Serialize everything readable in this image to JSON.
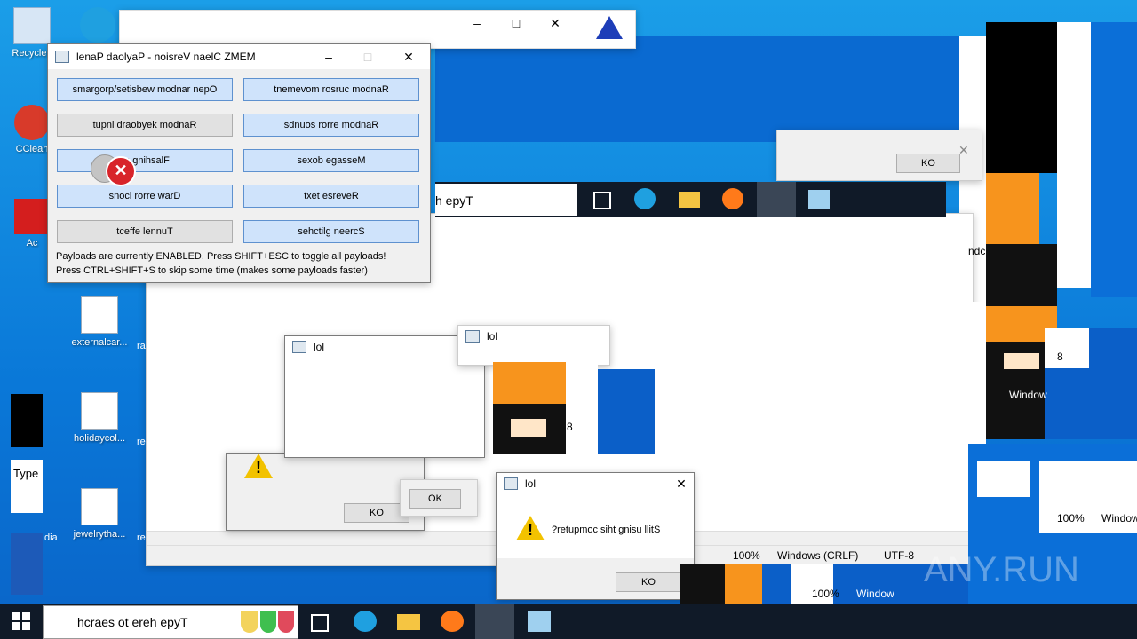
{
  "desktop": {
    "icons": [
      {
        "label": "Recycle Bin",
        "short": "Recycle I"
      },
      {
        "label": "CCleaner",
        "short": "CClean"
      },
      {
        "label": "Acrobat",
        "short": "Ac"
      },
      {
        "label": "externalcar...",
        "short": "externalcar..."
      },
      {
        "label": "holidaycol...",
        "short": "holidaycol..."
      },
      {
        "label": "jewelrytha...",
        "short": "jewelrytha..."
      }
    ],
    "side_labels": [
      "ra",
      "re",
      "re",
      "Type",
      "dia"
    ]
  },
  "memz_panel": {
    "title": "lenaP daolyaP - noisreV naelC ZMEM",
    "buttons": [
      {
        "label": "smargorp/setisbew modnar nepO",
        "style": "blue"
      },
      {
        "label": "tnemevom rosruc modnaR",
        "style": "blue"
      },
      {
        "label": "tupni draobyek modnaR",
        "style": "gray"
      },
      {
        "label": "sdnuos rorre modnaR",
        "style": "blue"
      },
      {
        "label": "ss gnihsalF",
        "style": "blue"
      },
      {
        "label": "sexob egasseM",
        "style": "blue"
      },
      {
        "label": "snoci rorre warD",
        "style": "blue"
      },
      {
        "label": "txet esreveR",
        "style": "blue"
      },
      {
        "label": "tceffe lennuT",
        "style": "gray"
      },
      {
        "label": "sehctilg neercS",
        "style": "blue"
      }
    ],
    "status_line1": "Payloads are currently ENABLED. Press SHIFT+ESC to toggle all payloads!",
    "status_line2": "Press CTRL+SHIFT+S to skip some time (makes some payloads faster)"
  },
  "dialogs": {
    "lol_title": "lol",
    "message": "?retupmoc siht gnisu llitS",
    "ok_label": "KO",
    "ok_label_alt": "OK"
  },
  "notepad": {
    "zoom": "100%",
    "eol": "Windows (CRLF)",
    "encoding": "UTF-8",
    "stray_8": "8",
    "window_frag": "Window",
    "ndc_frag": "ndc"
  },
  "taskbar": {
    "search_placeholder": "hcraes ot ereh epyT",
    "search_frag": "h epyT"
  },
  "watermark": "ANY.RUN"
}
